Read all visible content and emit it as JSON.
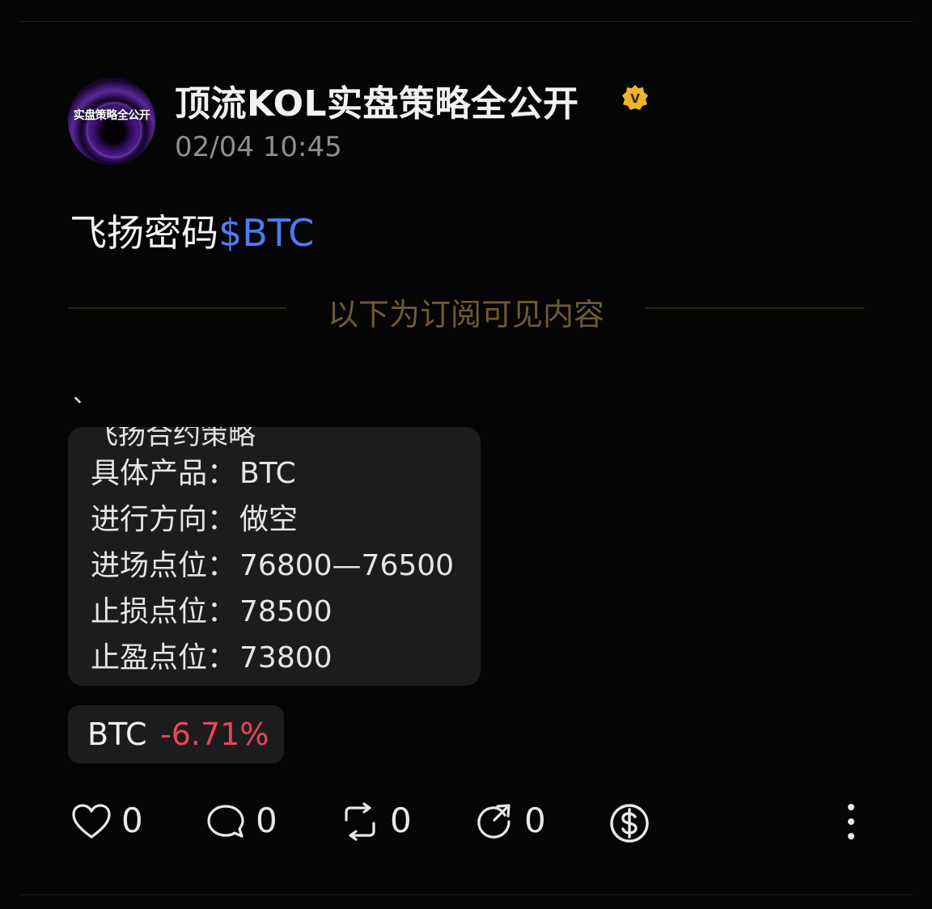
{
  "author": {
    "avatar_text": "实盘策略全公开",
    "name": "顶流KOL实盘策略全公开",
    "verified_badge": "V",
    "timestamp": "02/04 10:45"
  },
  "post": {
    "text": "飞扬密码",
    "ticker_tag": "$BTC",
    "subscriber_divider": "以下为订阅可见内容",
    "stray_mark": "、",
    "strategy": {
      "clipped_heading": "飞扬合约策略",
      "rows": [
        {
          "label": "具体产品：",
          "value": "BTC"
        },
        {
          "label": "进行方向：",
          "value": "做空"
        },
        {
          "label": "进场点位：",
          "value": "76800—76500"
        },
        {
          "label": "止损点位：",
          "value": "78500"
        },
        {
          "label": "止盈点位：",
          "value": "73800"
        }
      ]
    },
    "ticker_card": {
      "symbol": "BTC",
      "change": "-6.71%"
    }
  },
  "actions": {
    "like_count": "0",
    "comment_count": "0",
    "repost_count": "0",
    "share_count": "0"
  },
  "icons": {
    "like": "heart-icon",
    "comment": "comment-bubble-icon",
    "repost": "repost-icon",
    "share": "share-icon",
    "tip": "dollar-tip-icon",
    "more": "more-vertical-icon",
    "verified": "verified-badge-icon"
  },
  "colors": {
    "background": "#050505",
    "tag_blue": "#4b7cf3",
    "negative_red": "#e8475c",
    "badge_gold": "#f0b429",
    "divider_gold": "#6f5a34"
  }
}
